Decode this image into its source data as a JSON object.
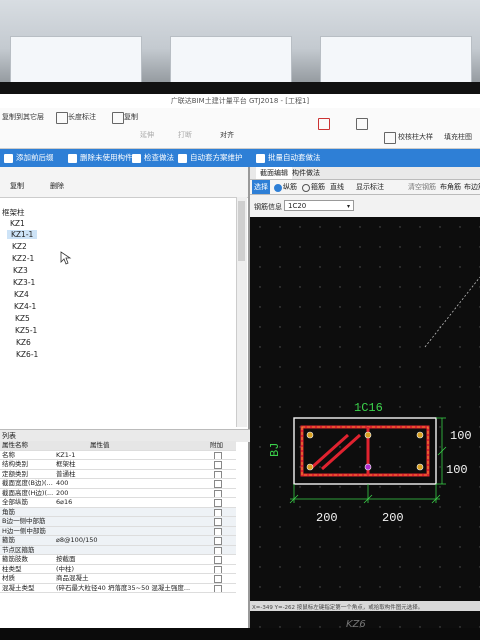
{
  "app_title": "广联达BIM土建计量平台 GTJ2018 - [工程1]",
  "ribbon": {
    "copy_to_other_layer": "复制到其它层",
    "length_label": "长度标注",
    "copy": "复制",
    "extend": "延伸",
    "break": "打断",
    "align": "对齐",
    "check_col_size": "校核柱大样",
    "fill_col_detail": "填充柱图"
  },
  "quickbar": {
    "add_prefix": "添加前后缀",
    "delete_unused": "删除未使用构件",
    "check_method": "检查做法",
    "auto_method": "自动套方案维护",
    "batch_auto_method": "批量自动套做法"
  },
  "left_toolbar": {
    "copy": "复制",
    "delete": "删除"
  },
  "tree": {
    "group": "框架柱",
    "items": [
      "KZ1",
      "KZ1-1",
      "KZ2",
      "KZ2-1",
      "KZ3",
      "KZ3-1",
      "KZ4",
      "KZ4-1",
      "KZ5",
      "KZ5-1",
      "KZ6",
      "KZ6-1"
    ],
    "selected_index": 1
  },
  "props": {
    "title": "列表",
    "col_name": "属性名称",
    "col_value": "属性值",
    "col_attach": "附加",
    "rows": [
      {
        "name": "名称",
        "value": "KZ1-1"
      },
      {
        "name": "结构类别",
        "value": "框架柱"
      },
      {
        "name": "定额类别",
        "value": "普通柱"
      },
      {
        "name": "截面宽度(B边)(...",
        "value": "400"
      },
      {
        "name": "截面高度(H边)(...",
        "value": "200"
      },
      {
        "name": "全部纵筋",
        "value": "6⌀16"
      },
      {
        "name": "角筋",
        "value": ""
      },
      {
        "name": "B边一侧中部筋",
        "value": ""
      },
      {
        "name": "H边一侧中部筋",
        "value": ""
      },
      {
        "name": "箍筋",
        "value": "⌀8@100/150"
      },
      {
        "name": "节点区箍筋",
        "value": ""
      },
      {
        "name": "箍筋肢数",
        "value": "按截面"
      },
      {
        "name": "柱类型",
        "value": "(中柱)"
      },
      {
        "name": "材质",
        "value": "商品混凝土"
      },
      {
        "name": "混凝土类型",
        "value": "(碎石最大粒径40 坍落度35~50 混凝土强度..."
      }
    ]
  },
  "right": {
    "tab_section_edit": "截面编辑",
    "tab_component_method": "构件做法",
    "select": "选择",
    "mode_longitudinal": "纵筋",
    "mode_stirrup": "箍筋",
    "mode_straight": "直线",
    "show_labels": "显示标注",
    "clear_rebar": "清空钢筋",
    "corner_rebar": "布角筋",
    "side_rebar": "布边筋",
    "rebar_info_label": "钢筋信息",
    "rebar_info_value": "1C20",
    "top_rebar_label": "1C16",
    "left_rebar_label": "BJ",
    "dim_right_upper": "100",
    "dim_right_lower": "100",
    "dim_bottom_left": "200",
    "dim_bottom_right": "200",
    "status_line": "X=-349 Y=-262 按鼠标左键指定第一个角点，或拾取构件图元选择。",
    "canvas_tag": "KZ6"
  },
  "colors": {
    "accent_blue": "#2e7fd6",
    "rebar": "#e0222f",
    "dim_green": "#3ad14a",
    "frame": "#f5f5f5"
  }
}
